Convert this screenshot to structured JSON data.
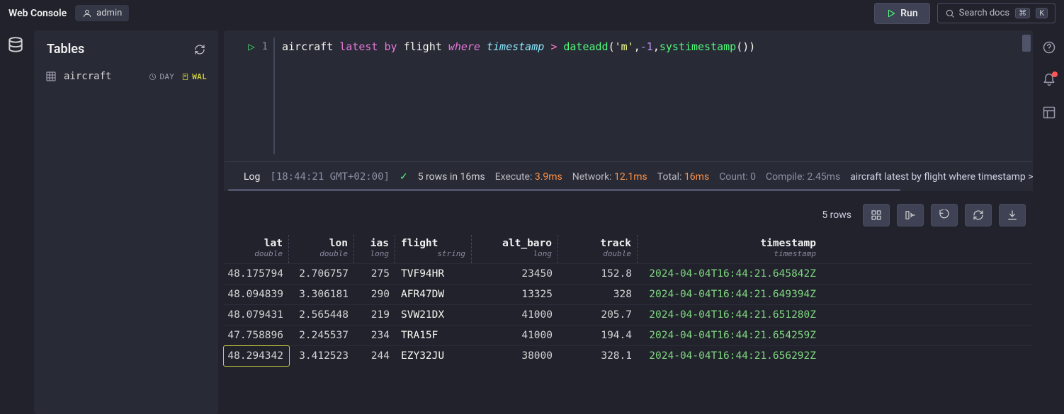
{
  "header": {
    "title": "Web Console",
    "user": "admin",
    "run_label": "Run",
    "search_placeholder": "Search docs",
    "kbd_cmd": "⌘",
    "kbd_k": "K"
  },
  "sidebar": {
    "heading": "Tables",
    "tables": [
      {
        "name": "aircraft",
        "partition": "DAY",
        "wal": "WAL"
      }
    ]
  },
  "editor": {
    "lineno": "1",
    "tokens": {
      "t1": "aircraft",
      "t2": "latest",
      "t3": "by",
      "t4": "flight",
      "t5": "where",
      "t6": "timestamp",
      "t7": ">",
      "t8": "dateadd",
      "t9": "(",
      "t10": "'m'",
      "t11": ",",
      "t12": "-1",
      "t13": ",",
      "t14": "systimestamp",
      "t15": "(",
      "t16": ")",
      "t17": ")"
    }
  },
  "log": {
    "label": "Log",
    "time": "[18:44:21 GMT+02:00]",
    "summary": "5 rows in 16ms",
    "exec_lbl": "Execute:",
    "exec_val": "3.9ms",
    "net_lbl": "Network:",
    "net_val": "12.1ms",
    "total_lbl": "Total:",
    "total_val": "16ms",
    "count_lbl": "Count: 0",
    "compile_lbl": "Compile: 2.45ms",
    "query": "aircraft latest by flight where timestamp > datea"
  },
  "results": {
    "row_count_label": "5 rows",
    "columns": [
      {
        "name": "lat",
        "type": "double"
      },
      {
        "name": "lon",
        "type": "double"
      },
      {
        "name": "ias",
        "type": "long"
      },
      {
        "name": "flight",
        "type": "string"
      },
      {
        "name": "alt_baro",
        "type": "long"
      },
      {
        "name": "track",
        "type": "double"
      },
      {
        "name": "timestamp",
        "type": "timestamp"
      }
    ],
    "rows": [
      {
        "lat": "48.175794",
        "lon": "2.706757",
        "ias": "275",
        "flight": "TVF94HR",
        "alt_baro": "23450",
        "track": "152.8",
        "timestamp": "2024-04-04T16:44:21.645842Z"
      },
      {
        "lat": "48.094839",
        "lon": "3.306181",
        "ias": "290",
        "flight": "AFR47DW",
        "alt_baro": "13325",
        "track": "328",
        "timestamp": "2024-04-04T16:44:21.649394Z"
      },
      {
        "lat": "48.079431",
        "lon": "2.565448",
        "ias": "219",
        "flight": "SVW21DX",
        "alt_baro": "41000",
        "track": "205.7",
        "timestamp": "2024-04-04T16:44:21.651280Z"
      },
      {
        "lat": "47.758896",
        "lon": "2.245537",
        "ias": "234",
        "flight": "TRA15F",
        "alt_baro": "41000",
        "track": "194.4",
        "timestamp": "2024-04-04T16:44:21.654259Z"
      },
      {
        "lat": "48.294342",
        "lon": "3.412523",
        "ias": "244",
        "flight": "EZY32JU",
        "alt_baro": "38000",
        "track": "328.1",
        "timestamp": "2024-04-04T16:44:21.656292Z"
      }
    ]
  }
}
